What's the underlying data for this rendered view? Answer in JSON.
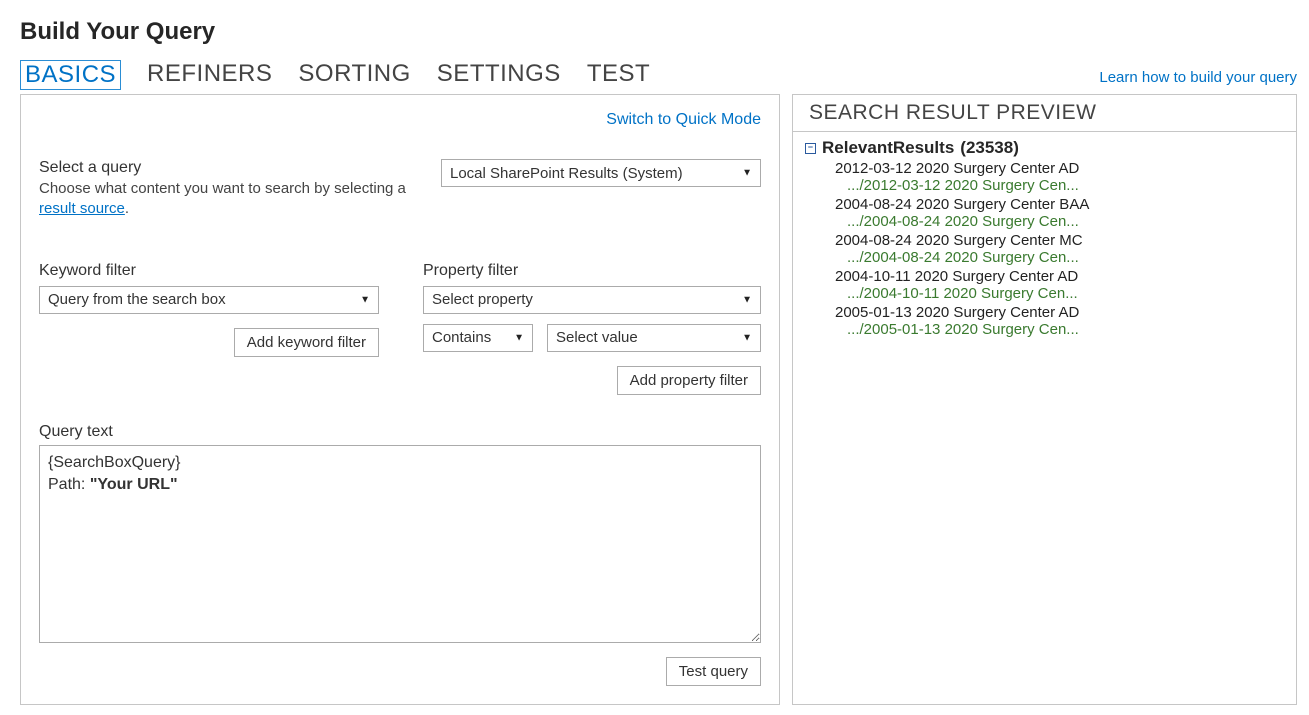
{
  "pageTitle": "Build Your Query",
  "learnLink": "Learn how to build your query",
  "tabs": {
    "items": [
      {
        "label": "BASICS",
        "active": true
      },
      {
        "label": "REFINERS",
        "active": false
      },
      {
        "label": "SORTING",
        "active": false
      },
      {
        "label": "SETTINGS",
        "active": false
      },
      {
        "label": "TEST",
        "active": false
      }
    ]
  },
  "basics": {
    "switchLink": "Switch to Quick Mode",
    "selectQuery": {
      "label": "Select a query",
      "descPrefix": "Choose what content you want to search by selecting a ",
      "descLink": "result source",
      "descSuffix": ".",
      "selected": "Local SharePoint Results (System)"
    },
    "keywordFilter": {
      "label": "Keyword filter",
      "selected": "Query from the search box",
      "addButton": "Add keyword filter"
    },
    "propertyFilter": {
      "label": "Property filter",
      "propertySelected": "Select property",
      "opSelected": "Contains",
      "valueSelected": "Select value",
      "addButton": "Add property filter"
    },
    "queryText": {
      "label": "Query text",
      "line1": "{SearchBoxQuery}",
      "line2Prefix": "Path: ",
      "line2Bold": "\"Your URL\""
    },
    "testButton": "Test query"
  },
  "preview": {
    "header": "SEARCH RESULT PREVIEW",
    "groupName": "RelevantResults",
    "groupCount": "(23538)",
    "results": [
      {
        "title": "2012-03-12 2020 Surgery Center AD",
        "path": ".../2012-03-12 2020 Surgery Cen..."
      },
      {
        "title": "2004-08-24 2020 Surgery Center BAA",
        "path": ".../2004-08-24 2020 Surgery Cen..."
      },
      {
        "title": "2004-08-24 2020 Surgery Center MC",
        "path": ".../2004-08-24 2020 Surgery Cen..."
      },
      {
        "title": "2004-10-11 2020 Surgery Center AD",
        "path": ".../2004-10-11 2020 Surgery Cen..."
      },
      {
        "title": "2005-01-13 2020 Surgery Center AD",
        "path": ".../2005-01-13 2020 Surgery Cen..."
      }
    ]
  }
}
